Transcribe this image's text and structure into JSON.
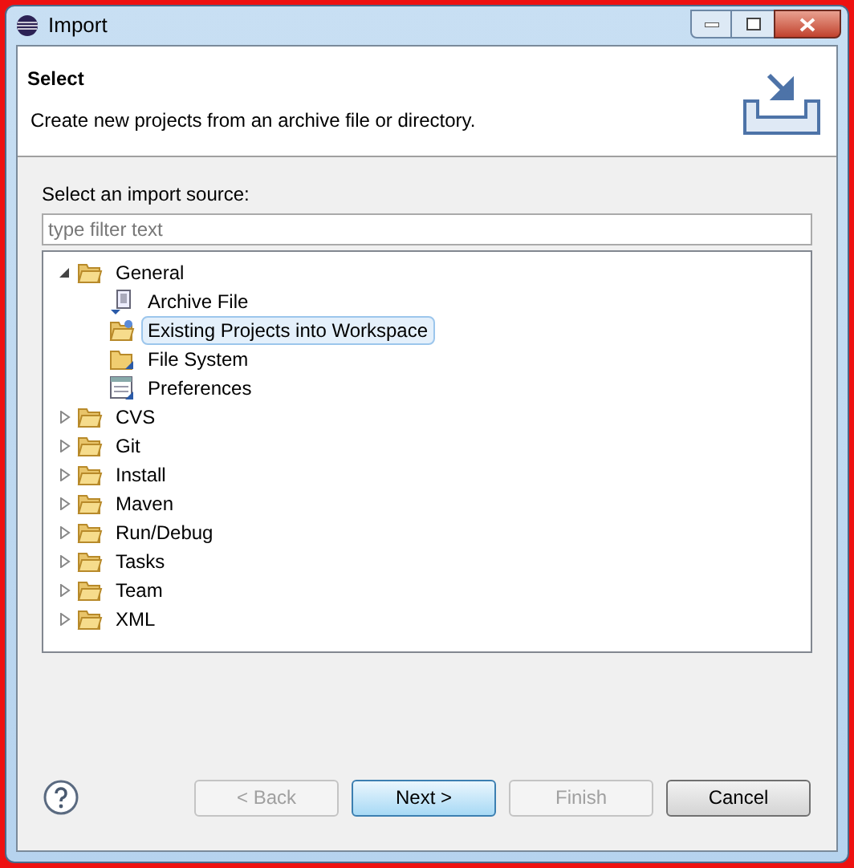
{
  "window": {
    "title": "Import"
  },
  "header": {
    "title": "Select",
    "description": "Create new projects from an archive file or directory."
  },
  "source_label": "Select an import source:",
  "filter": {
    "placeholder": "type filter text"
  },
  "tree": [
    {
      "label": "General",
      "expanded": true,
      "selected": false,
      "children": [
        {
          "label": "Archive File",
          "kind": "archive",
          "selected": false
        },
        {
          "label": "Existing Projects into Workspace",
          "kind": "project",
          "selected": true
        },
        {
          "label": "File System",
          "kind": "folder",
          "selected": false
        },
        {
          "label": "Preferences",
          "kind": "preferences",
          "selected": false
        }
      ]
    },
    {
      "label": "CVS",
      "expanded": false,
      "selected": false
    },
    {
      "label": "Git",
      "expanded": false,
      "selected": false
    },
    {
      "label": "Install",
      "expanded": false,
      "selected": false
    },
    {
      "label": "Maven",
      "expanded": false,
      "selected": false
    },
    {
      "label": "Run/Debug",
      "expanded": false,
      "selected": false
    },
    {
      "label": "Tasks",
      "expanded": false,
      "selected": false
    },
    {
      "label": "Team",
      "expanded": false,
      "selected": false
    },
    {
      "label": "XML",
      "expanded": false,
      "selected": false
    }
  ],
  "buttons": [
    {
      "label": "< Back",
      "disabled": true,
      "default": false
    },
    {
      "label": "Next >",
      "disabled": false,
      "default": true
    },
    {
      "label": "Finish",
      "disabled": true,
      "default": false
    },
    {
      "label": "Cancel",
      "disabled": false,
      "default": false
    }
  ]
}
